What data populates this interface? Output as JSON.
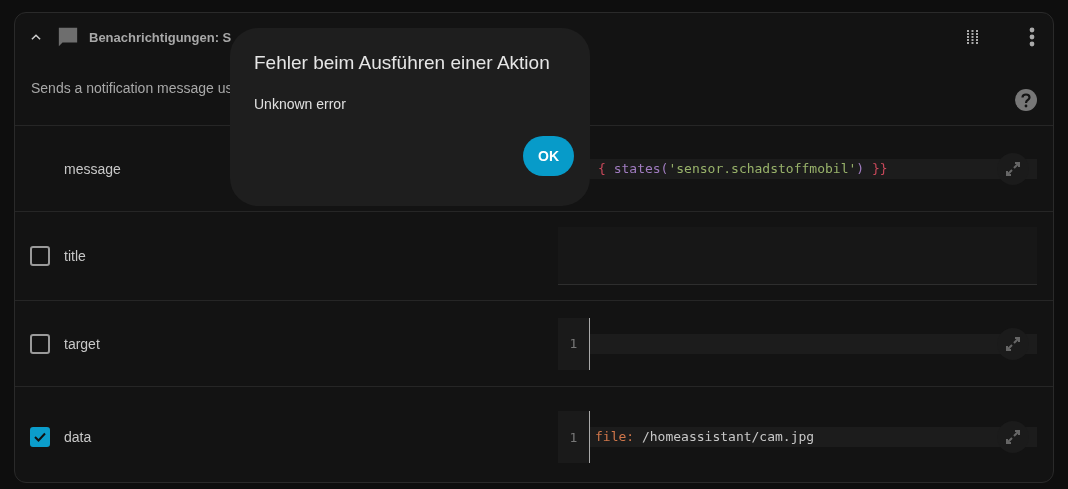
{
  "card": {
    "expanded": true,
    "title": "Benachrichtigungen: S",
    "description": "Sends a notification message us"
  },
  "fields": [
    {
      "label": "message",
      "kind": "code",
      "tokens": [
        {
          "kind": "bracket",
          "text": "{ "
        },
        {
          "kind": "func",
          "text": "states("
        },
        {
          "kind": "string",
          "text": "'sensor.schadstoffmobil'"
        },
        {
          "kind": "func",
          "text": ")"
        },
        {
          "kind": "bracket",
          "text": " }}"
        }
      ]
    },
    {
      "label": "title",
      "kind": "text",
      "checked": false
    },
    {
      "label": "target",
      "kind": "code",
      "checked": false,
      "line_number": "1"
    },
    {
      "label": "data",
      "kind": "code",
      "checked": true,
      "line_number": "1",
      "tokens": [
        {
          "kind": "key",
          "text": "file:"
        },
        {
          "kind": "plain",
          "text": " /homeassistant/cam.jpg"
        }
      ]
    }
  ],
  "dialog": {
    "title": "Fehler beim Ausführen einer Aktion",
    "message": "Unknown error",
    "button": "OK"
  }
}
